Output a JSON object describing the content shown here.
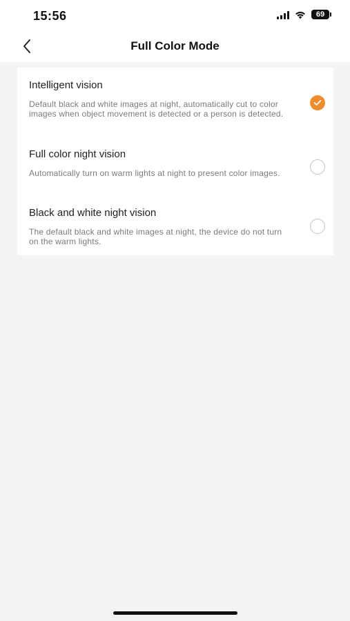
{
  "status_bar": {
    "time": "15:56",
    "battery": "69",
    "icons": [
      "signal-icon",
      "wifi-icon",
      "battery-icon"
    ]
  },
  "nav": {
    "title": "Full Color Mode",
    "back_icon": "chevron-left-icon"
  },
  "options": [
    {
      "title": "Intelligent vision",
      "description": "Default black and white images at night, automatically cut to color images when object movement is detected or a person is detected.",
      "selected": true
    },
    {
      "title": "Full color night vision",
      "description": "Automatically turn on warm lights at night to present color images.",
      "selected": false
    },
    {
      "title": "Black and white night vision",
      "description": "The default black and white images at night, the device do not turn on the warm lights.",
      "selected": false
    }
  ],
  "colors": {
    "accent": "#ee8d2e",
    "background": "#f2f3f5",
    "card": "#ffffff"
  }
}
